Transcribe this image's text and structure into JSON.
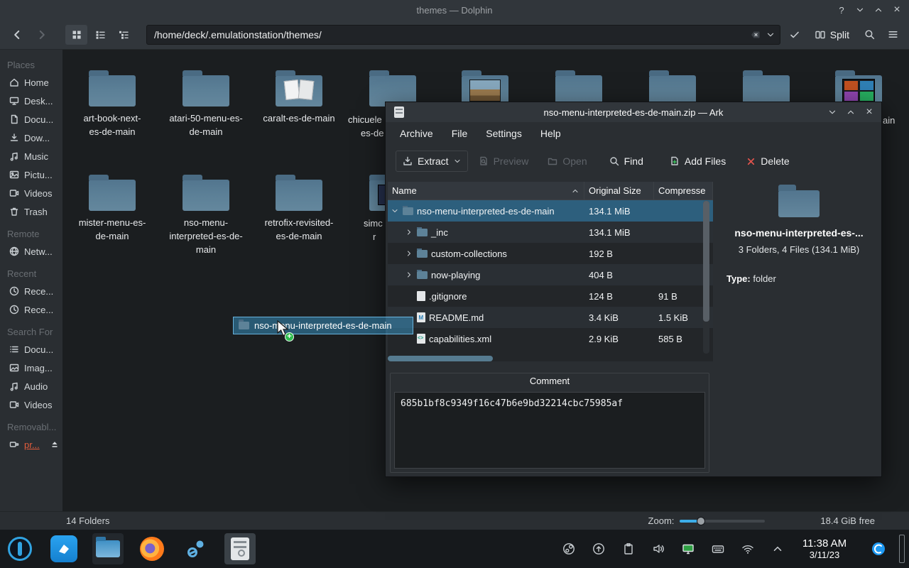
{
  "dolphin": {
    "title": "themes — Dolphin",
    "location": "/home/deck/.emulationstation/themes/",
    "toolbar": {
      "split": "Split"
    },
    "sidebar": {
      "sections": [
        {
          "header": "Places",
          "items": [
            "Home",
            "Desk...",
            "Docu...",
            "Dow...",
            "Music",
            "Pictu...",
            "Videos",
            "Trash"
          ]
        },
        {
          "header": "Remote",
          "items": [
            "Netw..."
          ]
        },
        {
          "header": "Recent",
          "items": [
            "Rece...",
            "Rece..."
          ]
        },
        {
          "header": "Search For",
          "items": [
            "Docu...",
            "Imag...",
            "Audio",
            "Videos"
          ]
        },
        {
          "header": "Removabl...",
          "items": [
            "pr..."
          ]
        }
      ]
    },
    "folders": [
      {
        "lines": [
          "art-book-next-",
          "es-de-main"
        ]
      },
      {
        "lines": [
          "atari-50-menu-es-",
          "de-main"
        ]
      },
      {
        "lines": [
          "caralt-es-de-main"
        ]
      },
      {
        "fragments": [
          "chicuele",
          "es-de"
        ]
      },
      {},
      {},
      {},
      {},
      {
        "fragments": [
          "ain"
        ]
      },
      {
        "lines": [
          "mister-menu-es-",
          "de-main"
        ]
      },
      {
        "lines": [
          "nso-menu-",
          "interpreted-es-de-",
          "main"
        ]
      },
      {
        "lines": [
          "retrofix-revisited-",
          "es-de-main"
        ]
      },
      {
        "fragments": [
          "simc",
          "r"
        ]
      }
    ],
    "drag_ghost": "nso-menu-interpreted-es-de-main",
    "status": {
      "folders": "14 Folders",
      "zoom": "Zoom:",
      "free": "18.4 GiB free"
    }
  },
  "ark": {
    "title": "nso-menu-interpreted-es-de-main.zip — Ark",
    "menu": [
      "Archive",
      "File",
      "Settings",
      "Help"
    ],
    "toolbar": {
      "extract": "Extract",
      "preview": "Preview",
      "open": "Open",
      "find": "Find",
      "add_files": "Add Files",
      "delete": "Delete"
    },
    "columns": {
      "name": "Name",
      "original": "Original Size",
      "compressed": "Compresse"
    },
    "rows": [
      {
        "name": "nso-menu-interpreted-es-de-main",
        "original": "134.1 MiB",
        "compressed": ""
      },
      {
        "name": "_inc",
        "original": "134.1 MiB",
        "compressed": ""
      },
      {
        "name": "custom-collections",
        "original": "192 B",
        "compressed": ""
      },
      {
        "name": "now-playing",
        "original": "404 B",
        "compressed": ""
      },
      {
        "name": ".gitignore",
        "original": "124 B",
        "compressed": "91 B"
      },
      {
        "name": "README.md",
        "original": "3.4 KiB",
        "compressed": "1.5 KiB"
      },
      {
        "name": "capabilities.xml",
        "original": "2.9 KiB",
        "compressed": "585 B"
      }
    ],
    "info": {
      "name": "nso-menu-interpreted-es-...",
      "summary": "3 Folders, 4 Files (134.1 MiB)",
      "type_label": "Type:",
      "type_value": "folder"
    },
    "comment": {
      "title": "Comment",
      "text": "685b1bf8c9349f16c47b6e9bd32214cbc75985af"
    }
  },
  "taskbar": {
    "time": "11:38 AM",
    "date": "3/11/23"
  }
}
